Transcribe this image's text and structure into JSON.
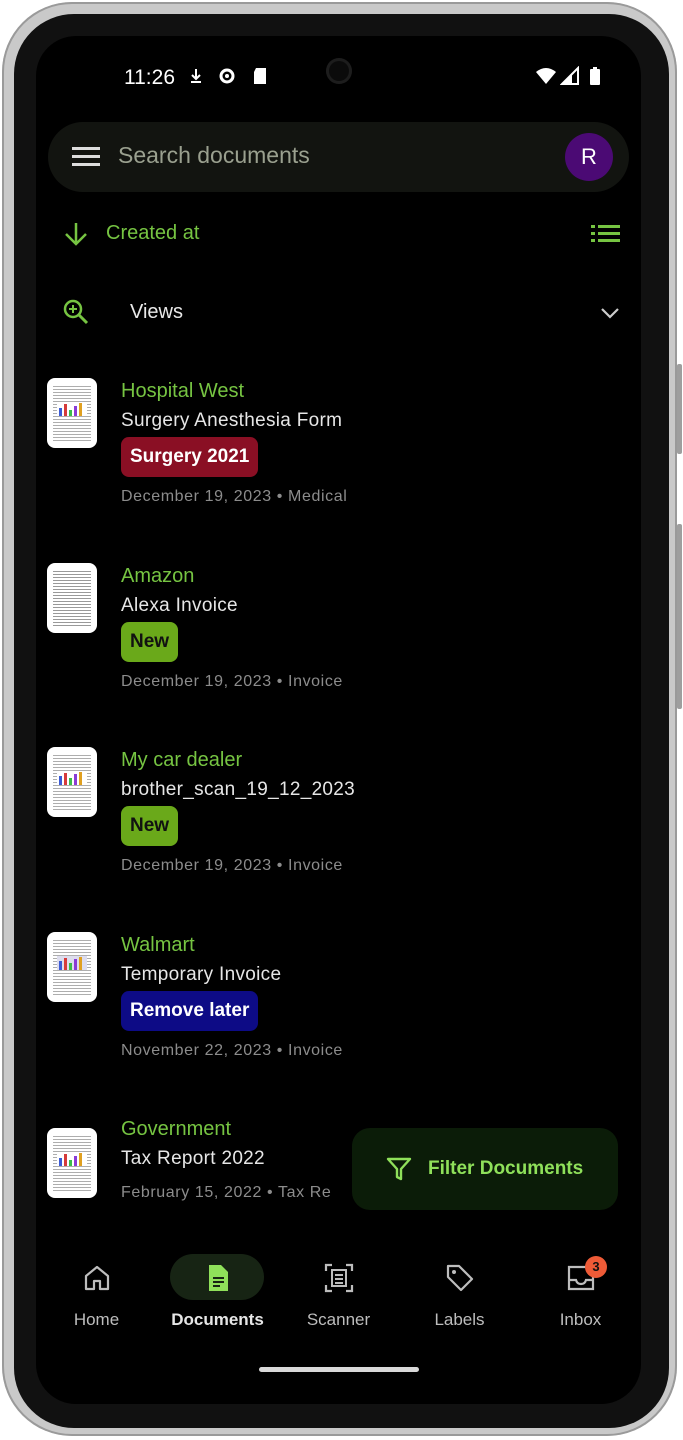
{
  "status": {
    "time": "11:26"
  },
  "search": {
    "placeholder": "Search documents",
    "avatar_letter": "R"
  },
  "sort": {
    "label": "Created at"
  },
  "views": {
    "label": "Views"
  },
  "documents": [
    {
      "correspondent": "Hospital West",
      "title": "Surgery Anesthesia Form",
      "tag": "Surgery 2021",
      "tag_bg": "#8a0f24",
      "tag_fg": "#ffffff",
      "date": "December 19, 2023",
      "type": "Medical"
    },
    {
      "correspondent": "Amazon",
      "title": "Alexa Invoice",
      "tag": "New",
      "tag_bg": "#6aa91a",
      "tag_fg": "#111111",
      "date": "December 19, 2023",
      "type": "Invoice"
    },
    {
      "correspondent": "My car dealer",
      "title": "brother_scan_19_12_2023",
      "tag": "New",
      "tag_bg": "#6aa91a",
      "tag_fg": "#111111",
      "date": "December 19, 2023",
      "type": "Invoice"
    },
    {
      "correspondent": "Walmart",
      "title": "Temporary Invoice",
      "tag": "Remove later",
      "tag_bg": "#0d0b86",
      "tag_fg": "#ffffff",
      "date": "November 22, 2023",
      "type": "Invoice"
    },
    {
      "correspondent": "Government",
      "title": "Tax Report 2022",
      "tag": "",
      "date": "February 15, 2022",
      "type": "Tax Re"
    }
  ],
  "fab": {
    "label": "Filter Documents"
  },
  "nav": [
    {
      "label": "Home",
      "icon": "home-icon"
    },
    {
      "label": "Documents",
      "icon": "document-icon",
      "active": true
    },
    {
      "label": "Scanner",
      "icon": "scanner-icon"
    },
    {
      "label": "Labels",
      "icon": "label-tag-icon"
    },
    {
      "label": "Inbox",
      "icon": "inbox-icon",
      "badge": "3"
    }
  ],
  "colors": {
    "accent": "#76c442",
    "background": "#000000",
    "surface": "#121410"
  }
}
